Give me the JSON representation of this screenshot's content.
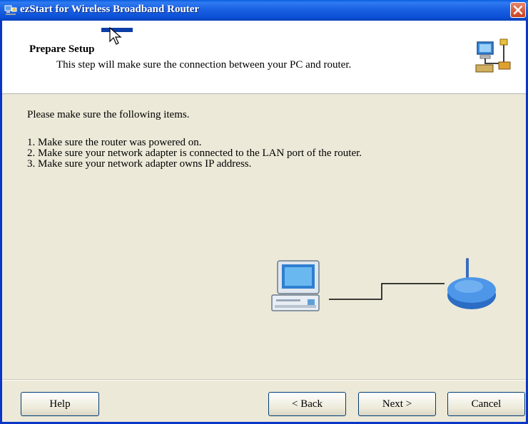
{
  "window": {
    "title": "ezStart for Wireless Broadband Router"
  },
  "header": {
    "title": "Prepare Setup",
    "subtitle": "This step will make sure the connection between your PC and router."
  },
  "content": {
    "intro": "Please make sure the following items.",
    "items": [
      "1. Make sure the router was powered on.",
      "2. Make sure your network adapter is connected to the LAN port of the router.",
      "3. Make sure your network adapter owns IP address."
    ]
  },
  "buttons": {
    "help": "Help",
    "back": "< Back",
    "next": "Next >",
    "cancel": "Cancel"
  },
  "icons": {
    "app": "network-app-icon",
    "close": "close-icon",
    "header": "network-setup-icon",
    "pc": "computer-icon",
    "router": "router-icon"
  },
  "colors": {
    "titlebar": "#0a5de0",
    "close_button": "#c8401f",
    "dialog_background": "#ece9d8"
  }
}
